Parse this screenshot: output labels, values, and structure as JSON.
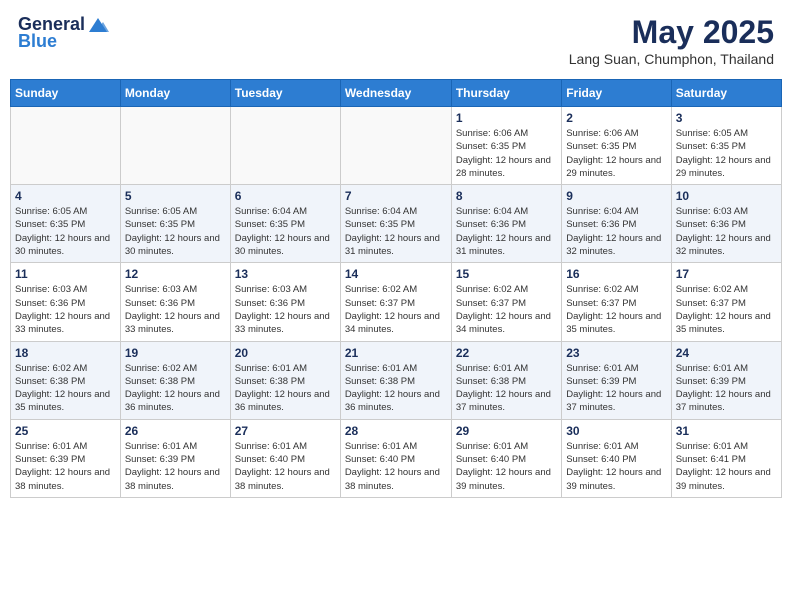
{
  "header": {
    "logo_general": "General",
    "logo_blue": "Blue",
    "month_title": "May 2025",
    "location": "Lang Suan, Chumphon, Thailand"
  },
  "weekdays": [
    "Sunday",
    "Monday",
    "Tuesday",
    "Wednesday",
    "Thursday",
    "Friday",
    "Saturday"
  ],
  "weeks": [
    [
      {
        "day": "",
        "sunrise": "",
        "sunset": "",
        "daylight": "",
        "empty": true
      },
      {
        "day": "",
        "sunrise": "",
        "sunset": "",
        "daylight": "",
        "empty": true
      },
      {
        "day": "",
        "sunrise": "",
        "sunset": "",
        "daylight": "",
        "empty": true
      },
      {
        "day": "",
        "sunrise": "",
        "sunset": "",
        "daylight": "",
        "empty": true
      },
      {
        "day": "1",
        "sunrise": "Sunrise: 6:06 AM",
        "sunset": "Sunset: 6:35 PM",
        "daylight": "Daylight: 12 hours and 28 minutes."
      },
      {
        "day": "2",
        "sunrise": "Sunrise: 6:06 AM",
        "sunset": "Sunset: 6:35 PM",
        "daylight": "Daylight: 12 hours and 29 minutes."
      },
      {
        "day": "3",
        "sunrise": "Sunrise: 6:05 AM",
        "sunset": "Sunset: 6:35 PM",
        "daylight": "Daylight: 12 hours and 29 minutes."
      }
    ],
    [
      {
        "day": "4",
        "sunrise": "Sunrise: 6:05 AM",
        "sunset": "Sunset: 6:35 PM",
        "daylight": "Daylight: 12 hours and 30 minutes."
      },
      {
        "day": "5",
        "sunrise": "Sunrise: 6:05 AM",
        "sunset": "Sunset: 6:35 PM",
        "daylight": "Daylight: 12 hours and 30 minutes."
      },
      {
        "day": "6",
        "sunrise": "Sunrise: 6:04 AM",
        "sunset": "Sunset: 6:35 PM",
        "daylight": "Daylight: 12 hours and 30 minutes."
      },
      {
        "day": "7",
        "sunrise": "Sunrise: 6:04 AM",
        "sunset": "Sunset: 6:35 PM",
        "daylight": "Daylight: 12 hours and 31 minutes."
      },
      {
        "day": "8",
        "sunrise": "Sunrise: 6:04 AM",
        "sunset": "Sunset: 6:36 PM",
        "daylight": "Daylight: 12 hours and 31 minutes."
      },
      {
        "day": "9",
        "sunrise": "Sunrise: 6:04 AM",
        "sunset": "Sunset: 6:36 PM",
        "daylight": "Daylight: 12 hours and 32 minutes."
      },
      {
        "day": "10",
        "sunrise": "Sunrise: 6:03 AM",
        "sunset": "Sunset: 6:36 PM",
        "daylight": "Daylight: 12 hours and 32 minutes."
      }
    ],
    [
      {
        "day": "11",
        "sunrise": "Sunrise: 6:03 AM",
        "sunset": "Sunset: 6:36 PM",
        "daylight": "Daylight: 12 hours and 33 minutes."
      },
      {
        "day": "12",
        "sunrise": "Sunrise: 6:03 AM",
        "sunset": "Sunset: 6:36 PM",
        "daylight": "Daylight: 12 hours and 33 minutes."
      },
      {
        "day": "13",
        "sunrise": "Sunrise: 6:03 AM",
        "sunset": "Sunset: 6:36 PM",
        "daylight": "Daylight: 12 hours and 33 minutes."
      },
      {
        "day": "14",
        "sunrise": "Sunrise: 6:02 AM",
        "sunset": "Sunset: 6:37 PM",
        "daylight": "Daylight: 12 hours and 34 minutes."
      },
      {
        "day": "15",
        "sunrise": "Sunrise: 6:02 AM",
        "sunset": "Sunset: 6:37 PM",
        "daylight": "Daylight: 12 hours and 34 minutes."
      },
      {
        "day": "16",
        "sunrise": "Sunrise: 6:02 AM",
        "sunset": "Sunset: 6:37 PM",
        "daylight": "Daylight: 12 hours and 35 minutes."
      },
      {
        "day": "17",
        "sunrise": "Sunrise: 6:02 AM",
        "sunset": "Sunset: 6:37 PM",
        "daylight": "Daylight: 12 hours and 35 minutes."
      }
    ],
    [
      {
        "day": "18",
        "sunrise": "Sunrise: 6:02 AM",
        "sunset": "Sunset: 6:38 PM",
        "daylight": "Daylight: 12 hours and 35 minutes."
      },
      {
        "day": "19",
        "sunrise": "Sunrise: 6:02 AM",
        "sunset": "Sunset: 6:38 PM",
        "daylight": "Daylight: 12 hours and 36 minutes."
      },
      {
        "day": "20",
        "sunrise": "Sunrise: 6:01 AM",
        "sunset": "Sunset: 6:38 PM",
        "daylight": "Daylight: 12 hours and 36 minutes."
      },
      {
        "day": "21",
        "sunrise": "Sunrise: 6:01 AM",
        "sunset": "Sunset: 6:38 PM",
        "daylight": "Daylight: 12 hours and 36 minutes."
      },
      {
        "day": "22",
        "sunrise": "Sunrise: 6:01 AM",
        "sunset": "Sunset: 6:38 PM",
        "daylight": "Daylight: 12 hours and 37 minutes."
      },
      {
        "day": "23",
        "sunrise": "Sunrise: 6:01 AM",
        "sunset": "Sunset: 6:39 PM",
        "daylight": "Daylight: 12 hours and 37 minutes."
      },
      {
        "day": "24",
        "sunrise": "Sunrise: 6:01 AM",
        "sunset": "Sunset: 6:39 PM",
        "daylight": "Daylight: 12 hours and 37 minutes."
      }
    ],
    [
      {
        "day": "25",
        "sunrise": "Sunrise: 6:01 AM",
        "sunset": "Sunset: 6:39 PM",
        "daylight": "Daylight: 12 hours and 38 minutes."
      },
      {
        "day": "26",
        "sunrise": "Sunrise: 6:01 AM",
        "sunset": "Sunset: 6:39 PM",
        "daylight": "Daylight: 12 hours and 38 minutes."
      },
      {
        "day": "27",
        "sunrise": "Sunrise: 6:01 AM",
        "sunset": "Sunset: 6:40 PM",
        "daylight": "Daylight: 12 hours and 38 minutes."
      },
      {
        "day": "28",
        "sunrise": "Sunrise: 6:01 AM",
        "sunset": "Sunset: 6:40 PM",
        "daylight": "Daylight: 12 hours and 38 minutes."
      },
      {
        "day": "29",
        "sunrise": "Sunrise: 6:01 AM",
        "sunset": "Sunset: 6:40 PM",
        "daylight": "Daylight: 12 hours and 39 minutes."
      },
      {
        "day": "30",
        "sunrise": "Sunrise: 6:01 AM",
        "sunset": "Sunset: 6:40 PM",
        "daylight": "Daylight: 12 hours and 39 minutes."
      },
      {
        "day": "31",
        "sunrise": "Sunrise: 6:01 AM",
        "sunset": "Sunset: 6:41 PM",
        "daylight": "Daylight: 12 hours and 39 minutes."
      }
    ]
  ]
}
